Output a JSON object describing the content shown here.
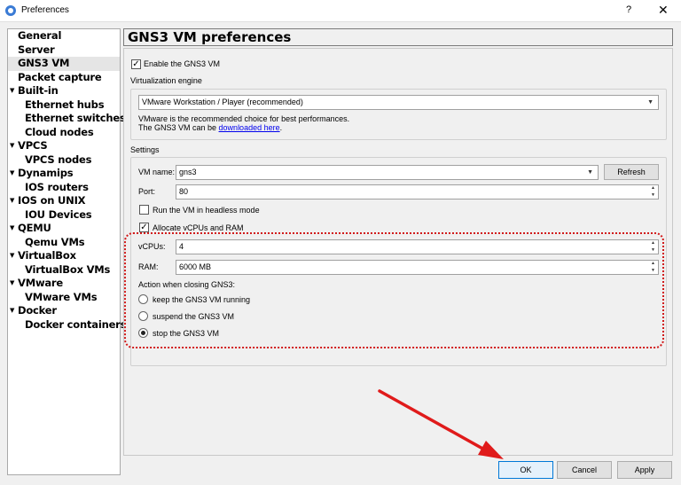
{
  "window": {
    "title": "Preferences",
    "help_glyph": "?",
    "close_glyph": "✕"
  },
  "sidebar": {
    "items": [
      {
        "label": "General",
        "level": 0,
        "expandable": false
      },
      {
        "label": "Server",
        "level": 0,
        "expandable": false
      },
      {
        "label": "GNS3 VM",
        "level": 0,
        "expandable": false,
        "selected": true
      },
      {
        "label": "Packet capture",
        "level": 0,
        "expandable": false
      },
      {
        "label": "Built-in",
        "level": 0,
        "expandable": true
      },
      {
        "label": "Ethernet hubs",
        "level": 1
      },
      {
        "label": "Ethernet switches",
        "level": 1
      },
      {
        "label": "Cloud nodes",
        "level": 1
      },
      {
        "label": "VPCS",
        "level": 0,
        "expandable": true
      },
      {
        "label": "VPCS nodes",
        "level": 1
      },
      {
        "label": "Dynamips",
        "level": 0,
        "expandable": true
      },
      {
        "label": "IOS routers",
        "level": 1
      },
      {
        "label": "IOS on UNIX",
        "level": 0,
        "expandable": true
      },
      {
        "label": "IOU Devices",
        "level": 1
      },
      {
        "label": "QEMU",
        "level": 0,
        "expandable": true
      },
      {
        "label": "Qemu VMs",
        "level": 1
      },
      {
        "label": "VirtualBox",
        "level": 0,
        "expandable": true
      },
      {
        "label": "VirtualBox VMs",
        "level": 1
      },
      {
        "label": "VMware",
        "level": 0,
        "expandable": true
      },
      {
        "label": "VMware VMs",
        "level": 1
      },
      {
        "label": "Docker",
        "level": 0,
        "expandable": true
      },
      {
        "label": "Docker containers",
        "level": 1
      }
    ]
  },
  "main": {
    "title": "GNS3 VM preferences",
    "enable_label": "Enable the GNS3 VM",
    "enable_checked": true,
    "virtualization_label": "Virtualization engine",
    "engine_value": "VMware Workstation / Player (recommended)",
    "info_line1": "VMware is the recommended choice for best performances.",
    "info_line2_prefix": "The GNS3 VM can be ",
    "info_link": "downloaded here",
    "info_line2_suffix": ".",
    "settings_label": "Settings",
    "vm_name_label": "VM name:",
    "vm_name_value": "gns3",
    "refresh_label": "Refresh",
    "port_label": "Port:",
    "port_value": "80",
    "headless_label": "Run the VM in headless mode",
    "headless_checked": false,
    "allocate_label": "Allocate vCPUs and RAM",
    "allocate_checked": true,
    "vcpus_label": "vCPUs:",
    "vcpus_value": "4",
    "ram_label": "RAM:",
    "ram_value": "6000 MB",
    "action_label": "Action when closing GNS3:",
    "actions": [
      {
        "label": "keep the GNS3 VM running",
        "selected": false
      },
      {
        "label": "suspend the GNS3 VM",
        "selected": false
      },
      {
        "label": "stop the GNS3 VM",
        "selected": true
      }
    ]
  },
  "footer": {
    "ok_label": "OK",
    "cancel_label": "Cancel",
    "apply_label": "Apply"
  },
  "colors": {
    "annotation": "#d11a1a",
    "link": "#0000ee",
    "default_button_border": "#0078d7"
  }
}
